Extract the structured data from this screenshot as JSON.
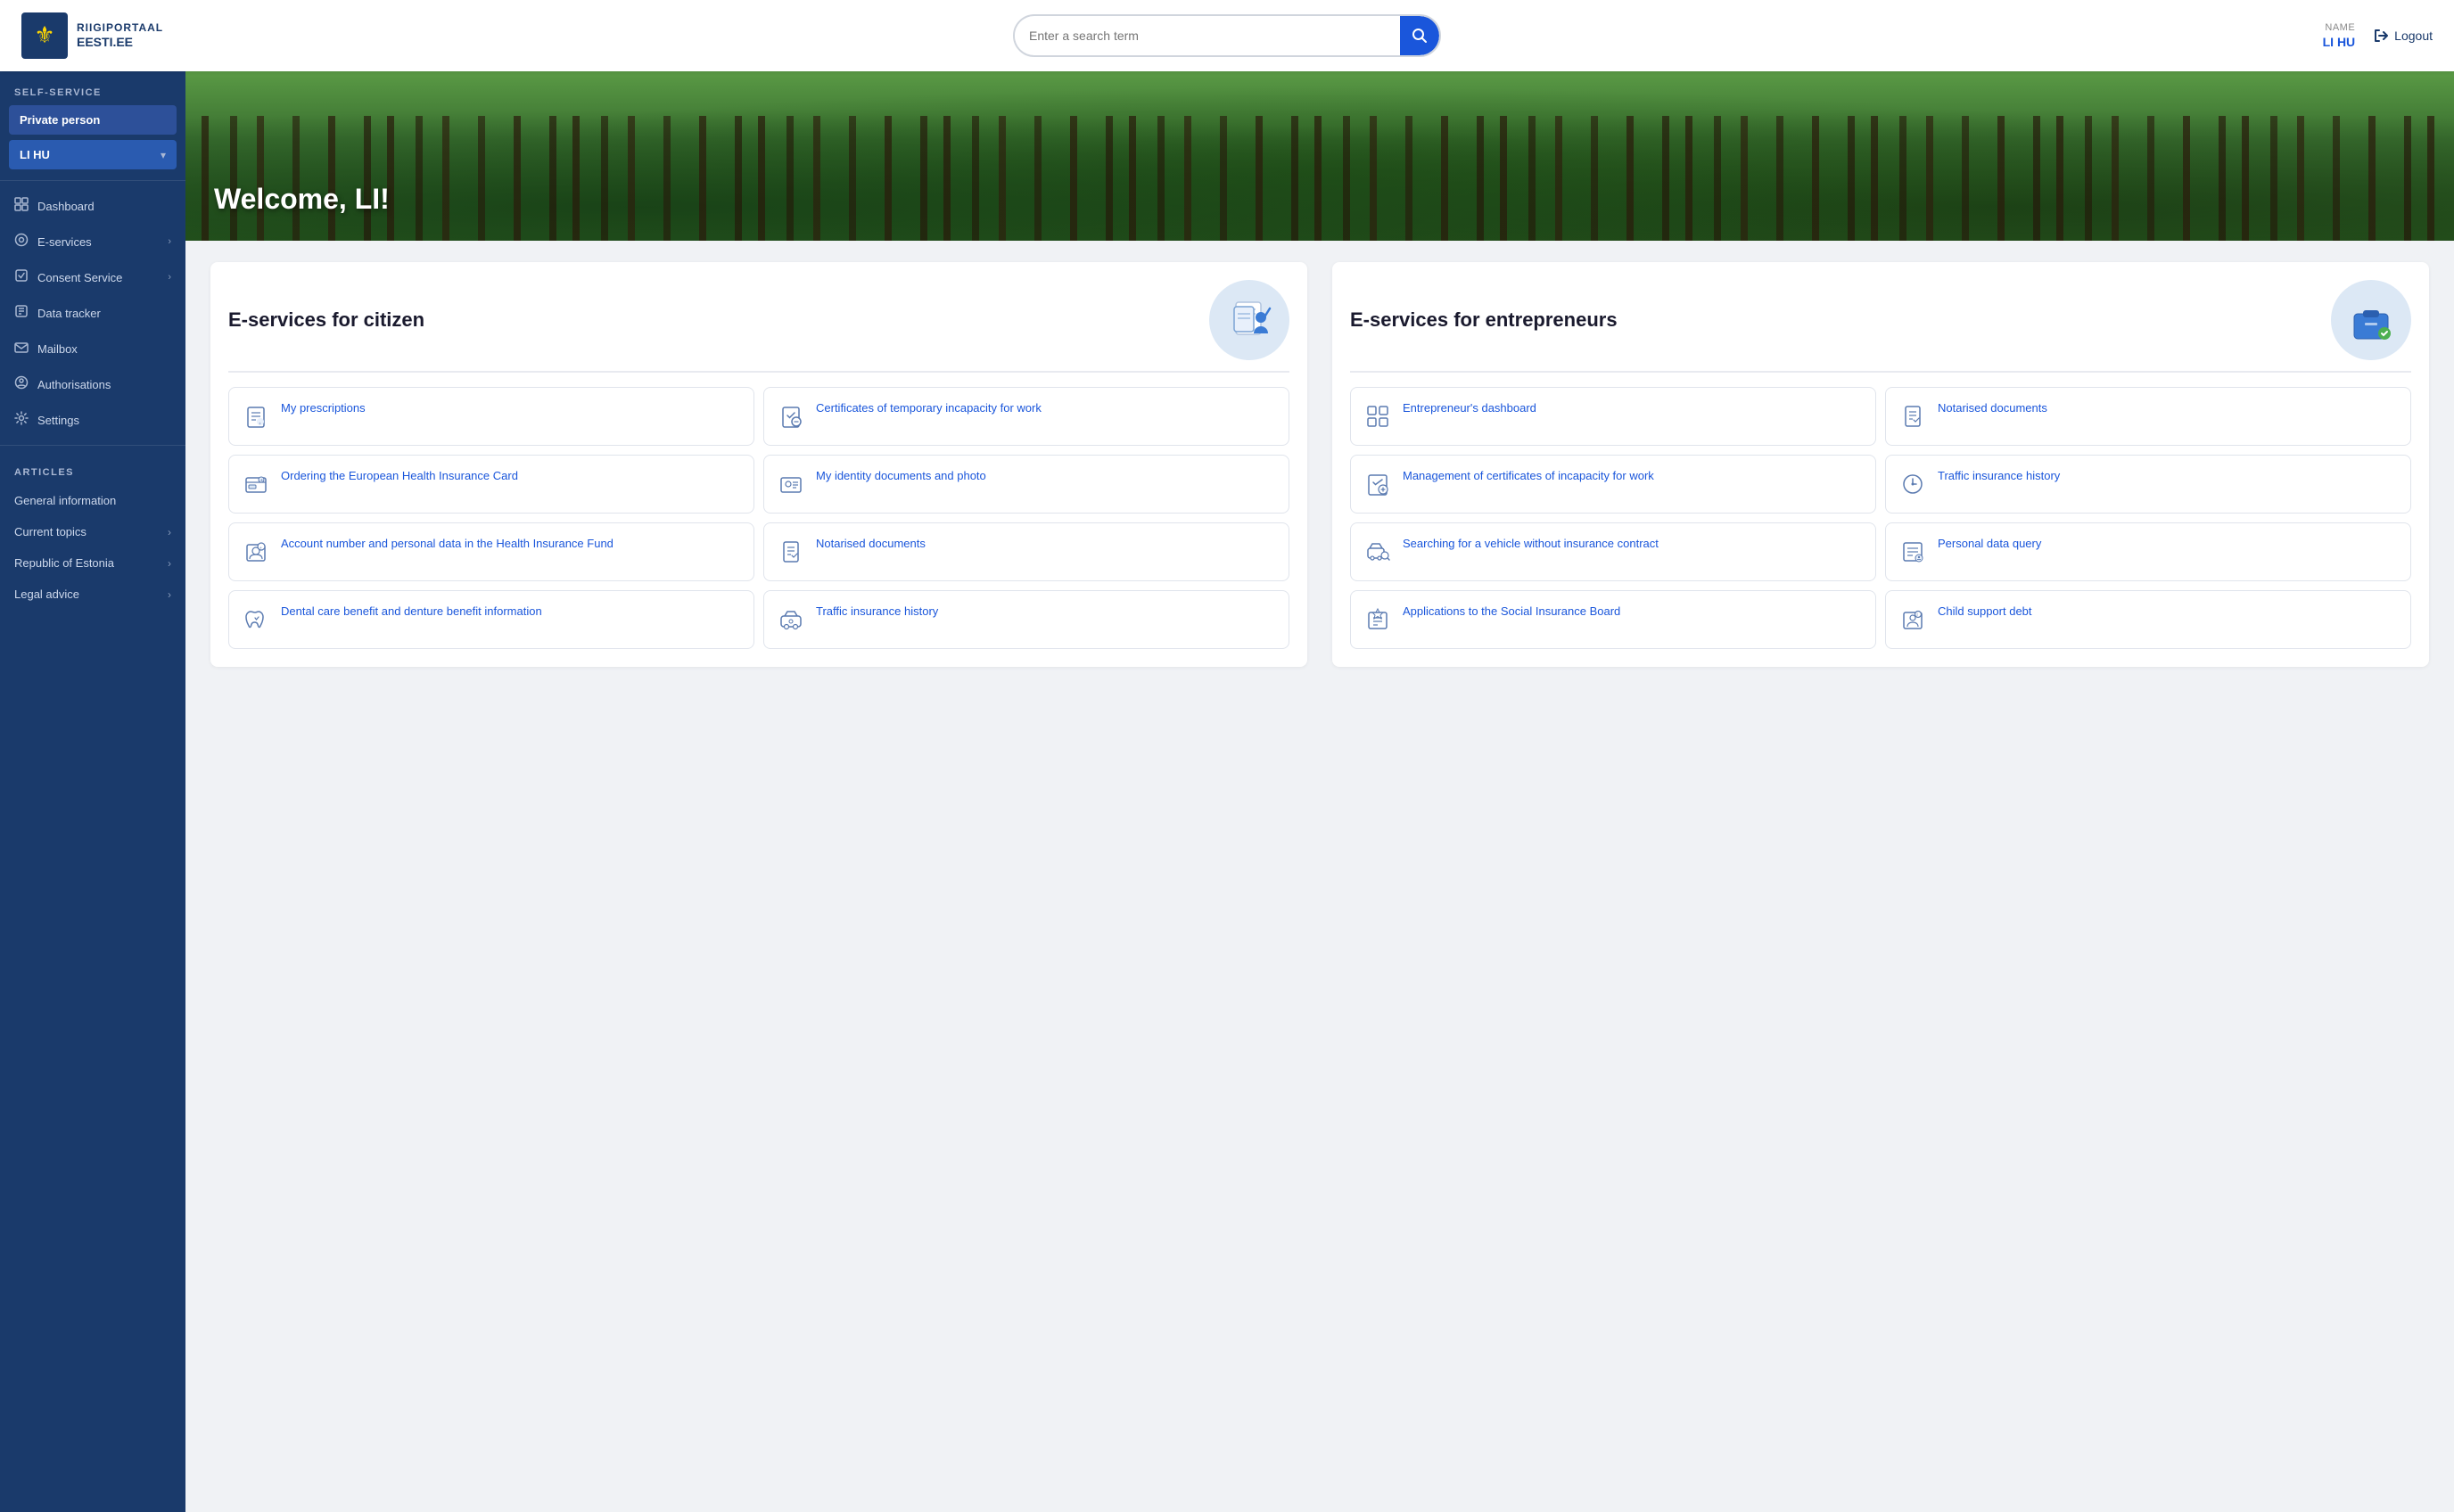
{
  "header": {
    "portal_name": "RIIGIPORTAAL",
    "portal_domain": "EESTI.EE",
    "search_placeholder": "Enter a search term",
    "user_label": "NAME",
    "user_name": "LI HU",
    "logout_label": "Logout"
  },
  "sidebar": {
    "self_service_label": "SELF-SERVICE",
    "private_person_label": "Private person",
    "user_name": "LI HU",
    "nav_items": [
      {
        "id": "dashboard",
        "label": "Dashboard",
        "icon": "⊞",
        "arrow": false
      },
      {
        "id": "e-services",
        "label": "E-services",
        "icon": "◎",
        "arrow": true
      },
      {
        "id": "consent",
        "label": "Consent Service",
        "icon": "☐",
        "arrow": true
      },
      {
        "id": "data-tracker",
        "label": "Data tracker",
        "icon": "☐",
        "arrow": false
      },
      {
        "id": "mailbox",
        "label": "Mailbox",
        "icon": "✉",
        "arrow": false
      },
      {
        "id": "authorisations",
        "label": "Authorisations",
        "icon": "◎",
        "arrow": false
      },
      {
        "id": "settings",
        "label": "Settings",
        "icon": "⚙",
        "arrow": false
      }
    ],
    "articles_label": "ARTICLES",
    "general_info_label": "General information",
    "article_items": [
      {
        "id": "current-topics",
        "label": "Current topics"
      },
      {
        "id": "republic",
        "label": "Republic of Estonia"
      },
      {
        "id": "legal",
        "label": "Legal advice"
      }
    ]
  },
  "hero": {
    "welcome_text": "Welcome, LI!"
  },
  "citizen_services": {
    "title": "E-services for citizen",
    "cards": [
      {
        "id": "prescriptions",
        "label": "My prescriptions",
        "icon": "💊"
      },
      {
        "id": "temp-incapacity",
        "label": "Certificates of temporary incapacity for work",
        "icon": "📋"
      },
      {
        "id": "european-card",
        "label": "Ordering the European Health Insurance Card",
        "icon": "🪪"
      },
      {
        "id": "identity-docs",
        "label": "My identity documents and photo",
        "icon": "👤"
      },
      {
        "id": "account-health",
        "label": "Account number and personal data in the Health Insurance Fund",
        "icon": "🏥"
      },
      {
        "id": "notarised",
        "label": "Notarised documents",
        "icon": "📄"
      },
      {
        "id": "dental",
        "label": "Dental care benefit and denture benefit information",
        "icon": "🦷"
      },
      {
        "id": "traffic-history-citizen",
        "label": "Traffic insurance history",
        "icon": "🚗"
      }
    ]
  },
  "entrepreneur_services": {
    "title": "E-services for entrepreneurs",
    "cards": [
      {
        "id": "entrepreneur-dashboard",
        "label": "Entrepreneur's dashboard",
        "icon": "📊"
      },
      {
        "id": "notarised-ent",
        "label": "Notarised documents",
        "icon": "📄"
      },
      {
        "id": "mgmt-incapacity",
        "label": "Management of certificates of incapacity for work",
        "icon": "📋"
      },
      {
        "id": "traffic-insurance-hist",
        "label": "Traffic insurance history",
        "icon": "🚗"
      },
      {
        "id": "search-vehicle",
        "label": "Searching for a vehicle without insurance contract",
        "icon": "🚙"
      },
      {
        "id": "personal-data-query",
        "label": "Personal data query",
        "icon": "🔍"
      },
      {
        "id": "social-insurance",
        "label": "Applications to the Social Insurance Board",
        "icon": "📝"
      },
      {
        "id": "child-support",
        "label": "Child support debt",
        "icon": "👶"
      }
    ]
  }
}
